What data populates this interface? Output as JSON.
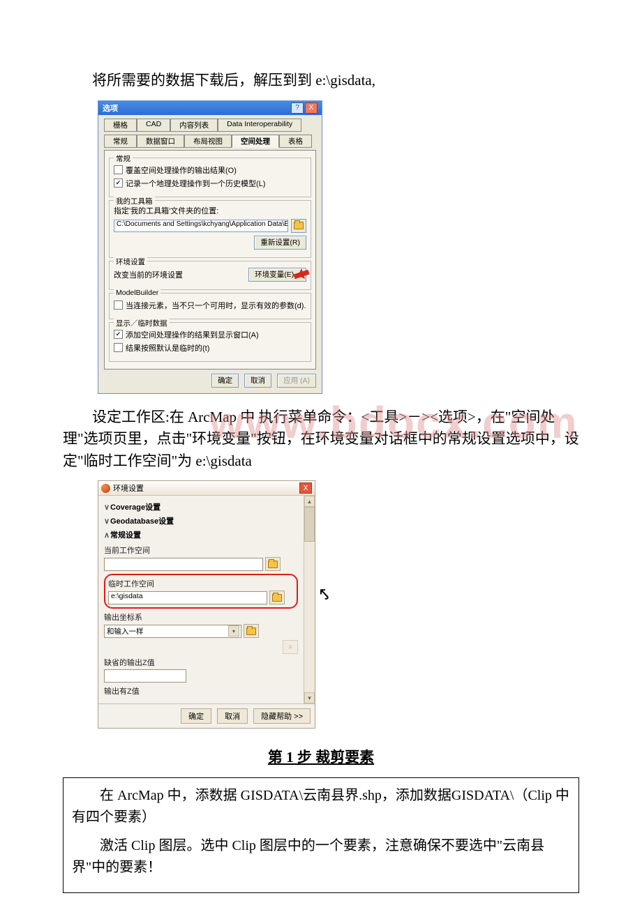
{
  "doc": {
    "intro": "将所需要的数据下载后，解压到到 e:\\gisdata,",
    "para2": "设定工作区:在 ArcMap 中 执行菜单命令：<工具>－><选项>，在\"空间处理\"选项页里，点击\"环境变量\"按钮，在环境变量对话框中的常规设置选项中，设定\"临时工作空间\"为 e:\\gisdata",
    "step_title": "第 1 步 裁剪要素",
    "box_p1": "在 ArcMap 中，添数据 GISDATA\\云南县界.shp，添加数据GISDATA\\（Clip 中有四个要素）",
    "box_p2": "激活 Clip 图层。选中 Clip 图层中的一个要素，注意确保不要选中\"云南县界\"中的要素！"
  },
  "watermark": "www.bdocx.com",
  "dialog1": {
    "title": "选项",
    "help_icon": "?",
    "close_icon": "X",
    "tabs_row1": [
      "栅格",
      "CAD",
      "内容列表",
      "Data Interoperability"
    ],
    "tabs_row2": [
      "常规",
      "数据窗口",
      "布局视图",
      "空间处理",
      "表格"
    ],
    "grp_general": {
      "label": "常规",
      "cb1": "覆盖空间处理操作的输出结果(O)",
      "cb2": "记录一个地理处理操作到一个历史模型(L)"
    },
    "grp_toolbox": {
      "label": "我的工具箱",
      "hint": "指定'我的工具箱'文件夹的位置:",
      "path": "C:\\Documents and Settings\\kchyang\\Application Data\\E",
      "reset": "重新设置(R)"
    },
    "grp_env": {
      "label": "环境设置",
      "hint": "改变当前的环境设置",
      "btn": "环境变量(E)..."
    },
    "grp_model": {
      "label": "ModelBuilder",
      "cb": "当连接元素，当不只一个可用时，显示有效的参数(d)."
    },
    "grp_temp": {
      "label": "显示／临时数据",
      "cb1": "添加空间处理操作的结果到显示窗口(A)",
      "cb2": "结果按照默认是临时的(t)"
    },
    "ok": "确定",
    "cancel": "取消",
    "apply": "应用 (A)"
  },
  "dialog2": {
    "title": "环境设置",
    "acc1": "Coverage设置",
    "acc2": "Geodatabase设置",
    "acc3": "常规设置",
    "lbl_current": "当前工作空间",
    "lbl_temp": "临时工作空间",
    "val_temp": "e:\\gisdata",
    "lbl_coord": "输出坐标系",
    "val_coord": "和输入一样",
    "lbl_defaultz": "缺省的输出Z值",
    "lbl_hasz": "输出有Z值",
    "ok": "确定",
    "cancel": "取消",
    "hide_help": "隐藏帮助 >>"
  }
}
